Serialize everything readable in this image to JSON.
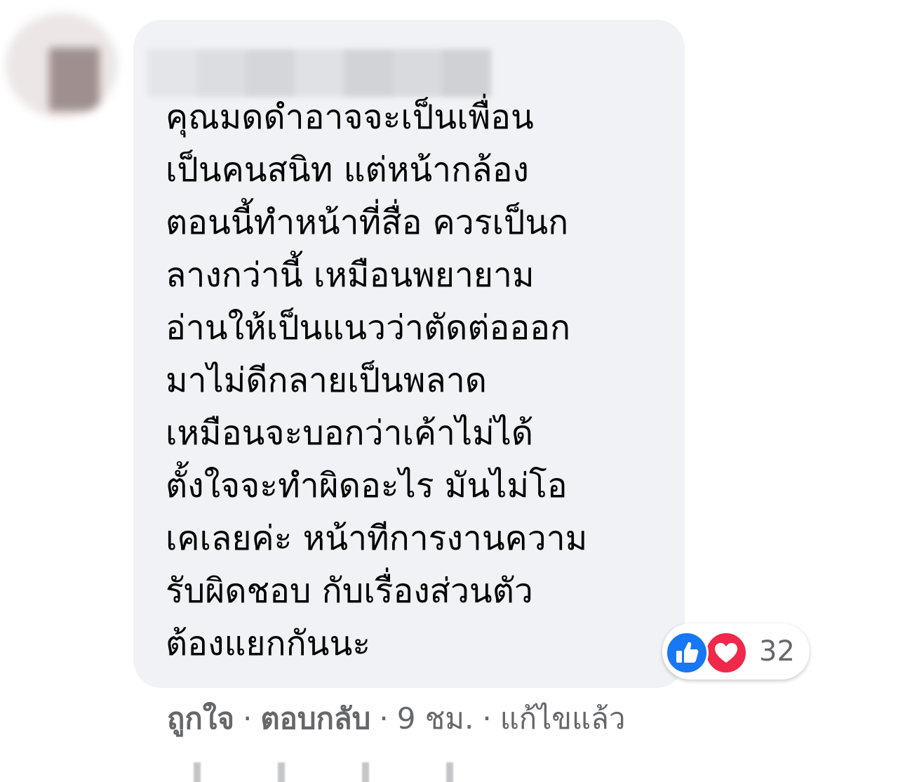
{
  "comment": {
    "lines": [
      "คุณมดดำอาจจะเป็นเพื่อน",
      "เป็นคนสนิท แต่หน้ากล้อง",
      "ตอนนี้ทำหน้าที่สื่อ ควรเป็นก",
      "ลางกว่านี้ เหมือนพยายาม",
      "อ่านให้เป็นแนวว่าตัดต่อออก",
      "มาไม่ดีกลายเป็นพลาด",
      "เหมือนจะบอกว่าเค้าไม่ได้",
      "ตั้งใจจะทำผิดอะไร มันไม่โอ",
      "เคเลยค่ะ หน้าทีการงานความ",
      "รับผิดชอบ กับเรื่องส่วนตัว",
      "ต้องแยกกันนะ"
    ]
  },
  "reactions": {
    "icons": [
      "like-icon",
      "love-icon"
    ],
    "count": "32",
    "colors": {
      "like": "#1877f2",
      "love": "#f02849"
    }
  },
  "actions": {
    "like_label": "ถูกใจ",
    "separator": "·",
    "reply_label": "ตอบกลับ",
    "time": "9 ชม.",
    "edited": "แก้ไขแล้ว"
  },
  "colors": {
    "bubble_bg": "#f0f2f5",
    "text": "#050505",
    "meta_text": "#65676b"
  }
}
